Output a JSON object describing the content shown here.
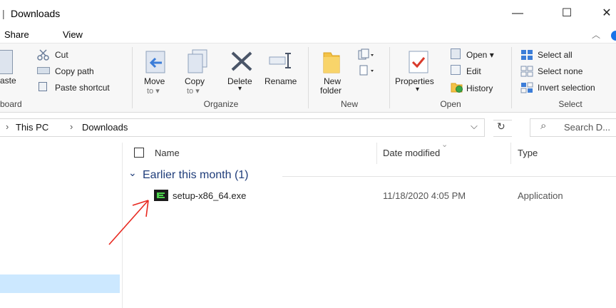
{
  "window": {
    "title": "Downloads",
    "minimize": "—",
    "maximize": "☐",
    "close": "✕"
  },
  "tabs": [
    "Share",
    "View"
  ],
  "ribbon": {
    "clipboard": {
      "paste_partial": "aste",
      "cut": "Cut",
      "copy_path": "Copy path",
      "paste_shortcut": "Paste shortcut",
      "group_partial": "board"
    },
    "organize": {
      "move_to": [
        "Move",
        "to ▾"
      ],
      "copy_to": [
        "Copy",
        "to ▾"
      ],
      "delete": "Delete",
      "delete_arrow": "▾",
      "rename": "Rename",
      "group": "Organize"
    },
    "new": {
      "new_folder": [
        "New",
        "folder"
      ],
      "group": "New"
    },
    "open": {
      "properties": "Properties",
      "properties_arrow": "▾",
      "open": "Open ▾",
      "edit": "Edit",
      "history": "History",
      "group": "Open"
    },
    "select": {
      "select_all": "Select all",
      "select_none": "Select none",
      "invert_selection": "Invert selection",
      "group": "Select"
    }
  },
  "address": {
    "prefix_chevron": "›",
    "crumbs": [
      "This PC",
      "Downloads"
    ],
    "crumb_sep": "›",
    "dropdown": "⌵",
    "refresh": "↻",
    "search_icon": "⌕",
    "search_placeholder": "Search D..."
  },
  "columns": {
    "name": "Name",
    "date_modified": "Date modified",
    "type": "Type",
    "sort_indicator": "⌄"
  },
  "groups": [
    {
      "title": "Earlier this month (1)",
      "chevron": "⌄",
      "files": [
        {
          "name": "setup-x86_64.exe",
          "date": "11/18/2020 4:05 PM",
          "type": "Application"
        }
      ]
    }
  ],
  "colors": {
    "accent": "#1a73e8",
    "selection": "#cce8ff",
    "annotation_arrow": "#e8281f",
    "group_title": "#1f3d7a"
  }
}
